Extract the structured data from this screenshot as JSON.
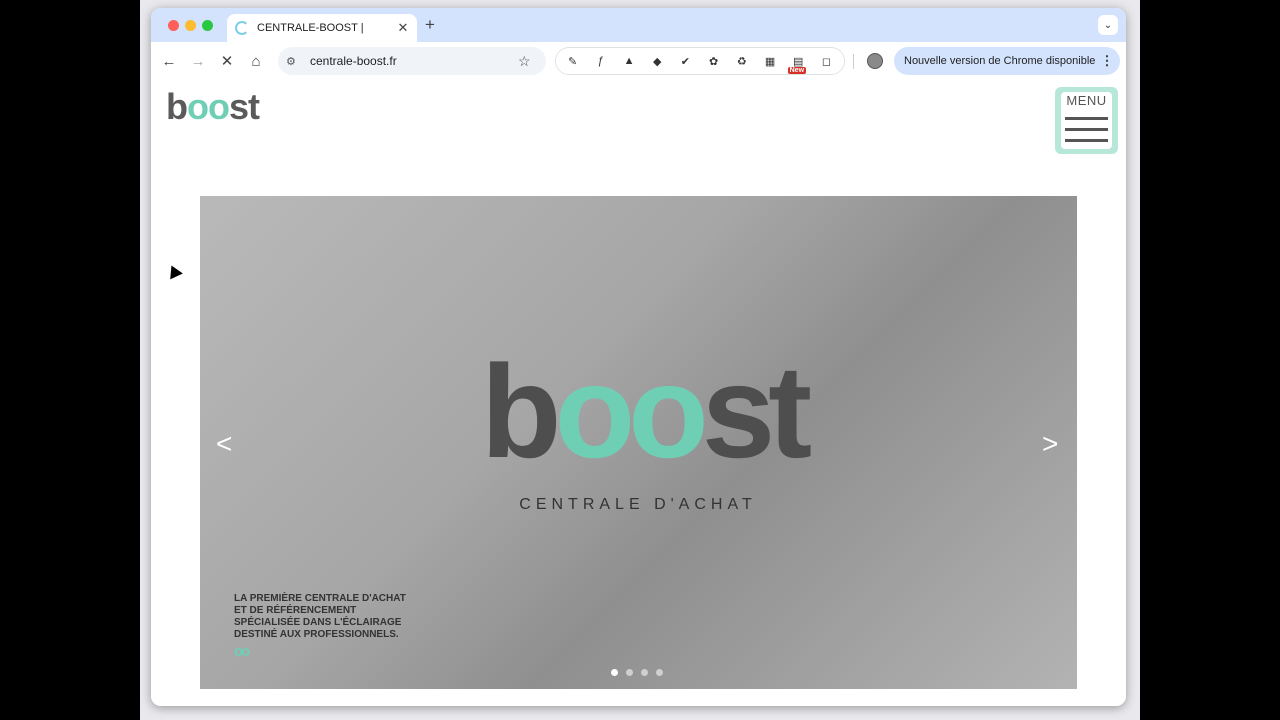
{
  "browser": {
    "tab_title": "CENTRALE-BOOST |",
    "new_tab_symbol": "+",
    "url": "centrale-boost.fr",
    "update_notice": "Nouvelle version de Chrome disponible",
    "extension_badge": "New",
    "extension_labels": [
      "ƒ",
      "fr",
      "▲",
      "◆",
      "✔",
      "✿",
      "♻",
      "▦",
      "▤",
      "◻"
    ]
  },
  "site": {
    "logo_b": "b",
    "logo_oo": "oo",
    "logo_st": "st",
    "menu_label": "MENU"
  },
  "hero": {
    "logo_b": "b",
    "logo_oo": "oo",
    "logo_st": "st",
    "tagline": "CENTRALE D'ACHAT",
    "caption_lines": [
      "LA PREMIÈRE CENTRALE D'ACHAT",
      "ET DE RÉFÉRENCEMENT",
      "SPÉCIALISÉE DANS L'ÉCLAIRAGE",
      "DESTINÉ AUX PROFESSIONNELS."
    ],
    "slide_count": 4,
    "active_slide": 1
  }
}
